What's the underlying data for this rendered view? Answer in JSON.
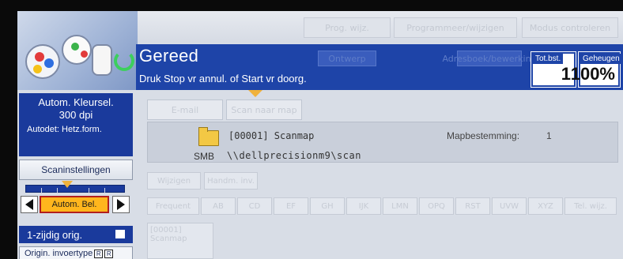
{
  "top_bar": {
    "buttons": [
      "Prog. wijz.",
      "Programmeer/wijzigen",
      "Modus controleren"
    ]
  },
  "header": {
    "status_title": "Gereed",
    "status_message": "Druk Stop  vr annul. of Start vr doorg.",
    "ghost_buttons": [
      "Ontwerp",
      "Adresboek/bewerking"
    ],
    "counters": [
      {
        "label": "Tot.bst.",
        "value": "1"
      },
      {
        "label": "Geheugen",
        "value": "100%"
      }
    ]
  },
  "left_panel": {
    "color_mode": "Autom. Kleursel.",
    "resolution": "300 dpi",
    "autodetect": "Autodet: Hetz.form.",
    "scan_settings_label": "Scaninstellingen",
    "density_label": "Autom. Bel.",
    "duplex_label": "1-zijdig orig.",
    "input_type_label": "Origin. invoertype"
  },
  "tabs": [
    "E-mail",
    "Scan naar map"
  ],
  "destination": {
    "id_name": "[00001] Scanmap",
    "protocol": "SMB",
    "path": "\\\\dellprecisionm9\\scan",
    "label": "Mapbestemming:",
    "count": "1"
  },
  "sub_buttons": [
    "Wijzigen",
    "Handm. inv."
  ],
  "index_tabs": [
    "Frequent",
    "AB",
    "CD",
    "EF",
    "GH",
    "IJK",
    "LMN",
    "OPQ",
    "RST",
    "UVW",
    "XYZ",
    "Tel. wijz."
  ],
  "folder_entry": {
    "line1": "[00001]",
    "line2": "Scanmap"
  }
}
